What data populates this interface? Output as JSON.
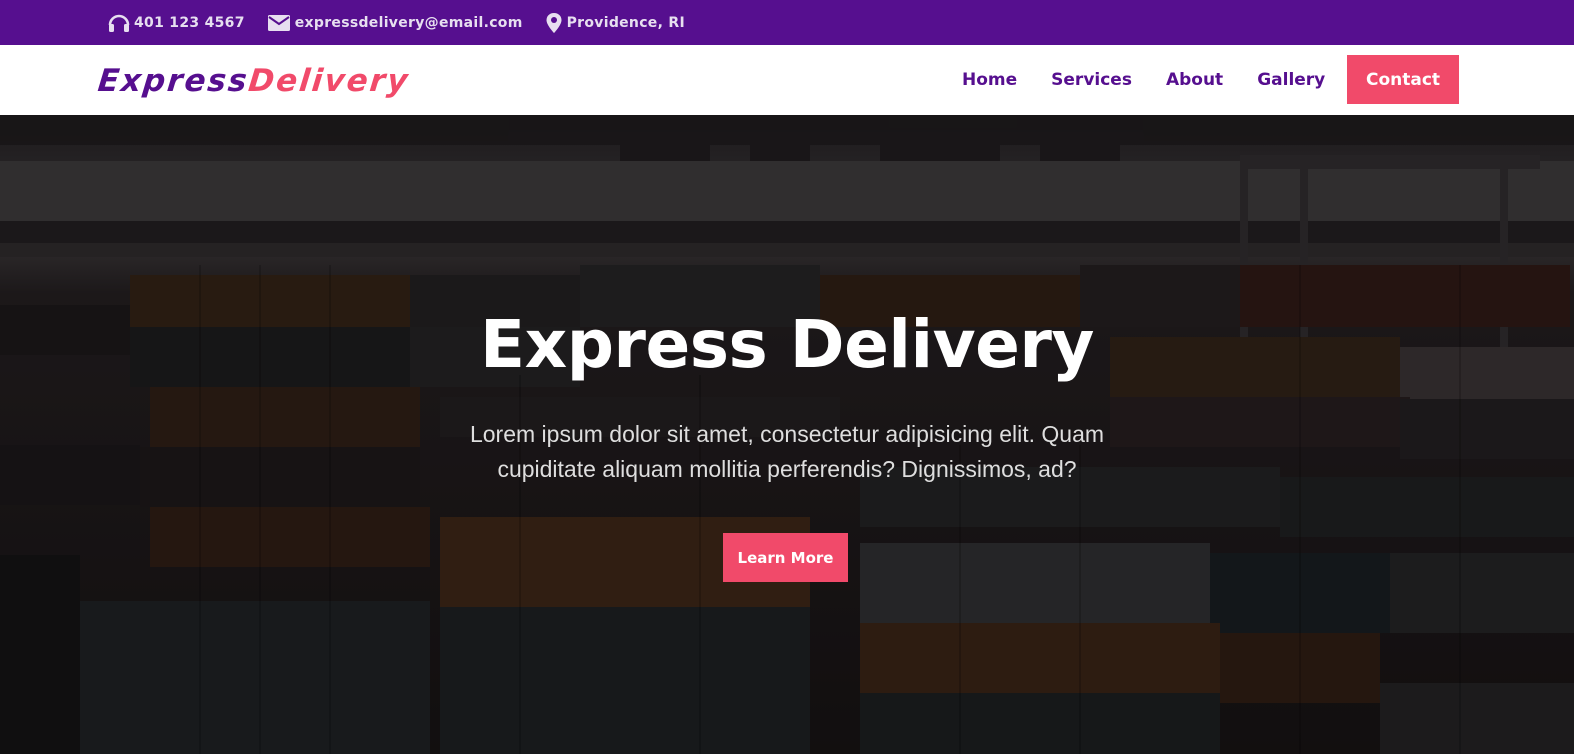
{
  "topbar": {
    "phone": "401 123 4567",
    "email": "expressdelivery@email.com",
    "location": "Providence, RI"
  },
  "brand": {
    "logo_part1": "Express",
    "logo_part2": "Delivery"
  },
  "nav": {
    "items": [
      "Home",
      "Services",
      "About",
      "Gallery"
    ],
    "contact_label": "Contact"
  },
  "hero": {
    "title": "Express Delivery",
    "text": "Lorem ipsum dolor sit amet, consectetur adipisicing elit. Quam cupiditate aliquam mollitia perferendis? Dignissimos, ad?",
    "button_label": "Learn More",
    "background": "container-port-photo"
  },
  "icons": {
    "phone": "headphones-icon",
    "email": "envelope-icon",
    "location": "map-pin-icon"
  },
  "colors": {
    "primary": "#560f8f",
    "accent": "#f14a6a",
    "white": "#ffffff"
  }
}
